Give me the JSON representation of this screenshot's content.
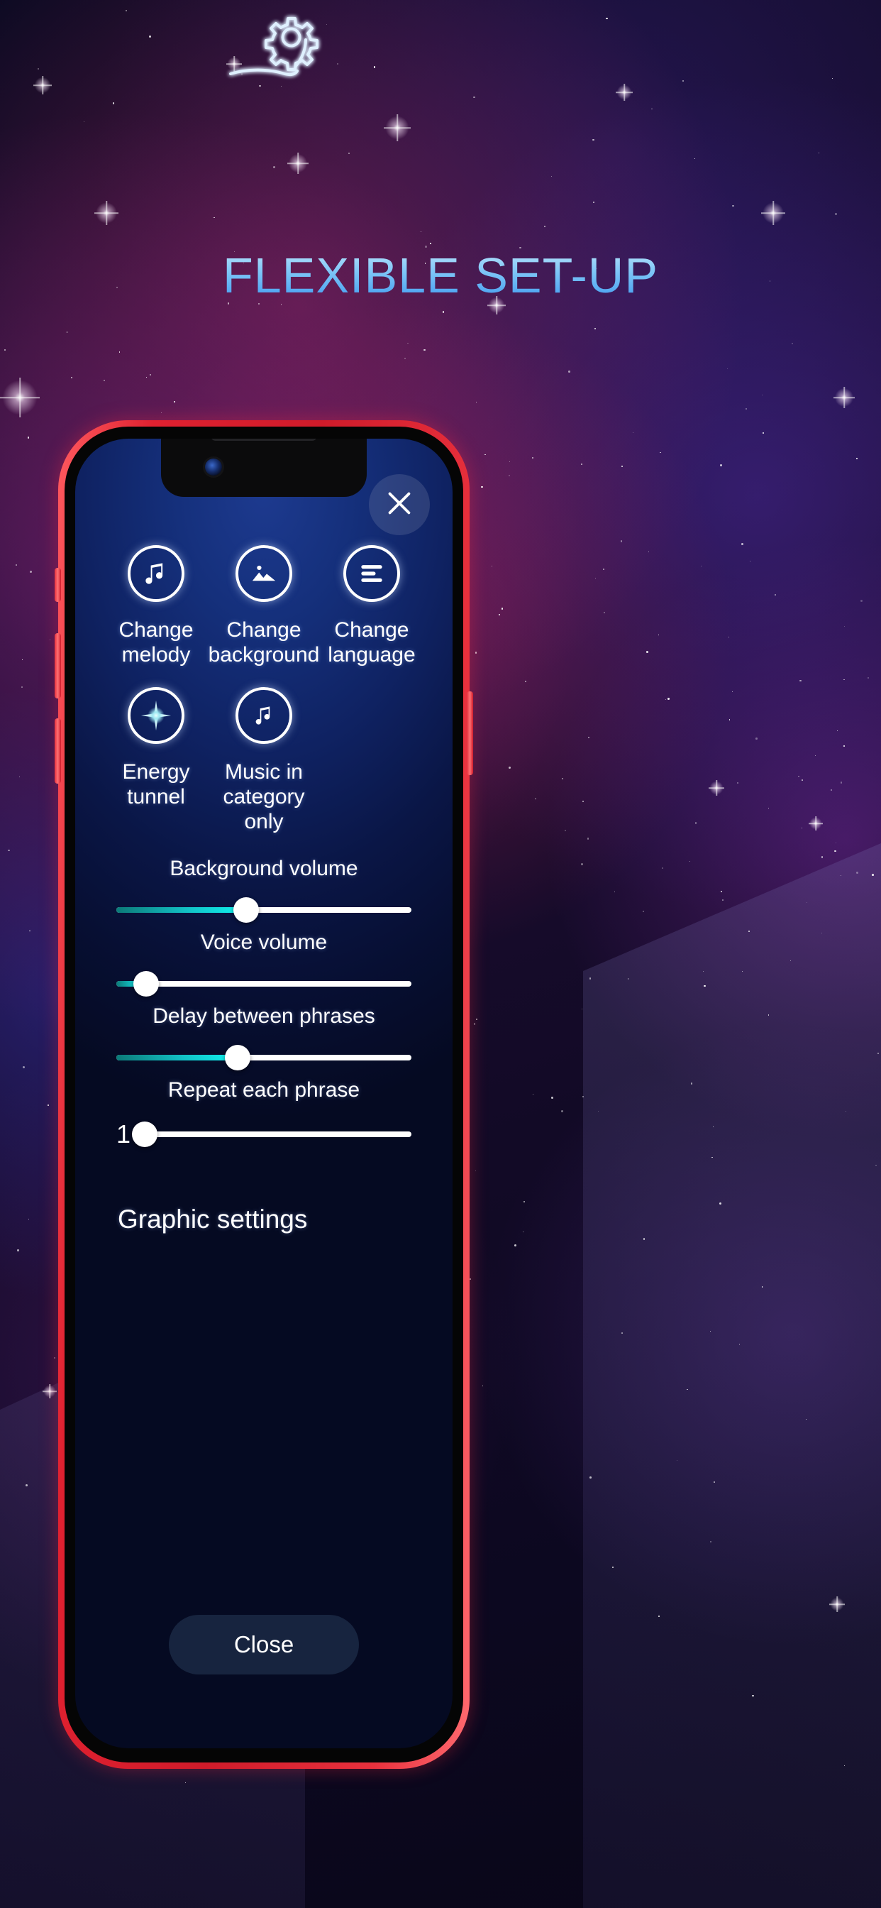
{
  "page": {
    "headline": "FLEXIBLE SET-UP",
    "logo_icon": "gear-with-9-icon",
    "accent_blue": "#7cc5f7",
    "accent_cyan": "#0ff3f0",
    "phone_frame_color": "#e02130",
    "screen_bg": "#0f2262"
  },
  "dialog": {
    "close_icon": "close-x-icon",
    "options": [
      {
        "icon": "music-note-icon",
        "label_line1": "Change",
        "label_line2": "melody"
      },
      {
        "icon": "image-icon",
        "label_line1": "Change",
        "label_line2": "background"
      },
      {
        "icon": "text-lines-icon",
        "label_line1": "Change",
        "label_line2": "language"
      },
      {
        "icon": "sparkle-star-icon",
        "label_line1": "Energy",
        "label_line2": "tunnel"
      },
      {
        "icon": "music-note-icon",
        "label_line1": "Music in",
        "label_line2": "category only"
      }
    ],
    "sliders": [
      {
        "title": "Background volume",
        "value_label": "",
        "percent": 44
      },
      {
        "title": "Voice volume",
        "value_label": "",
        "percent": 10
      },
      {
        "title": "Delay between phrases",
        "value_label": "",
        "percent": 41
      },
      {
        "title": "Repeat each phrase",
        "value_label": "1",
        "percent": 0
      }
    ],
    "graphic_settings_label": "Graphic settings",
    "close_button_label": "Close"
  }
}
